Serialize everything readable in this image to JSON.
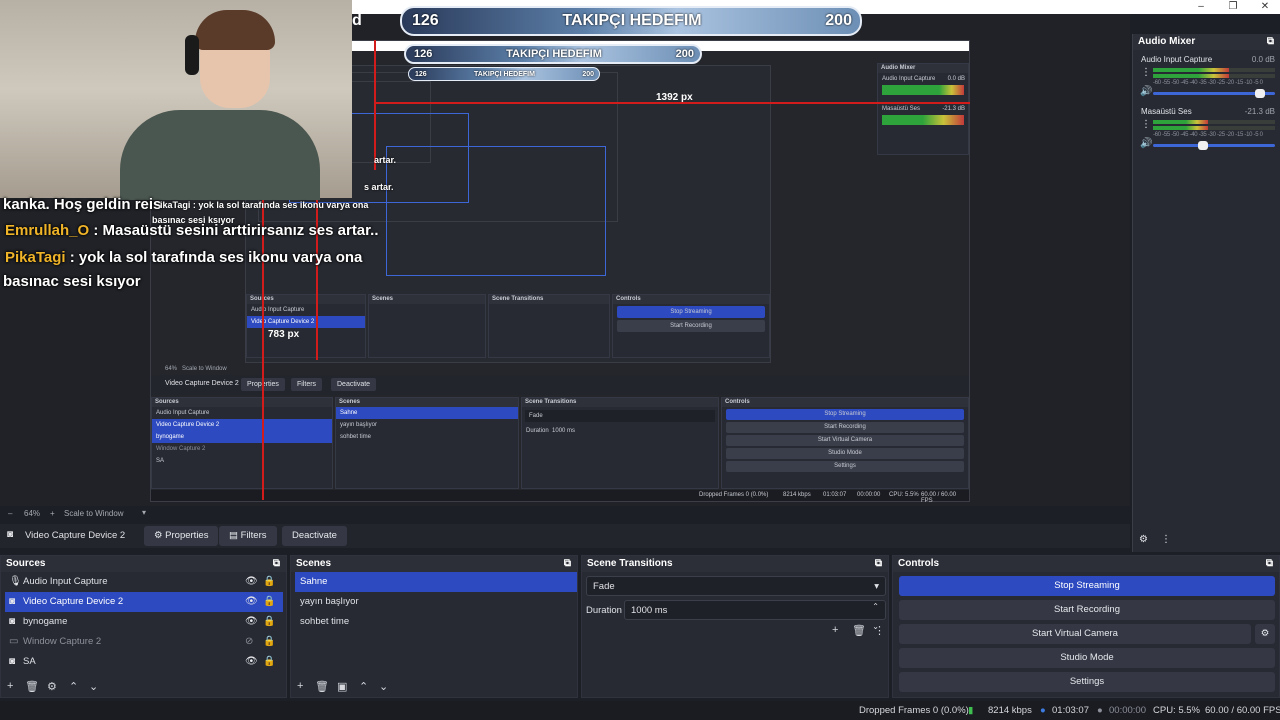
{
  "window": {
    "minimize": "–",
    "maximize": "❐",
    "close": "✕"
  },
  "goal": {
    "left_value": "126",
    "title": "TAKIPÇI HEDEFIM",
    "right_value": "200",
    "partial_label": "d"
  },
  "chat": {
    "line1": "kanka. Hoş geldin reis",
    "line2_nick": "Emrullah_O",
    "line2_msg": " : Masaüstü sesini arttirirsanız ses artar..",
    "line3_nick": "PikaTagi",
    "line3_msg": " : yok la sol tarafında ses ikonu varya ona",
    "line4": "basınac sesi ksıyor",
    "echo1": "ikaTagi : yok la sol tarafında ses ikonu varya ona",
    "echo2": "basınac sesi ksıyor",
    "echo3": "artar.",
    "echo4": "s artar."
  },
  "measure": {
    "width_label": "1392 px",
    "height_label": "783 px"
  },
  "preview_bar": {
    "zoom": "64%",
    "scale": "Scale to Window"
  },
  "context": {
    "source": "Video Capture Device 2",
    "properties": "Properties",
    "filters": "Filters",
    "deactivate": "Deactivate"
  },
  "mixer": {
    "title": "Audio Mixer",
    "channels": [
      {
        "name": "Audio Input Capture",
        "db": "0.0 dB",
        "level": 0.62,
        "volume": 0.92
      },
      {
        "name": "Masaüstü Ses",
        "db": "-21.3 dB",
        "level": 0.45,
        "volume": 0.45
      }
    ],
    "scale": "-60 -55 -50 -45 -40 -35 -30 -25 -20 -15 -10 -5 0"
  },
  "sources": {
    "title": "Sources",
    "items": [
      {
        "name": "Audio Input Capture",
        "icon": "mic-icon"
      },
      {
        "name": "Video Capture Device 2",
        "icon": "camera-icon"
      },
      {
        "name": "bynogame",
        "icon": "camera-icon"
      },
      {
        "name": "Window Capture 2",
        "icon": "window-icon"
      },
      {
        "name": "SA",
        "icon": "camera-icon"
      }
    ]
  },
  "scenes": {
    "title": "Scenes",
    "items": [
      "Sahne",
      "yayın başlıyor",
      "sohbet time"
    ]
  },
  "transitions": {
    "title": "Scene Transitions",
    "type": "Fade",
    "duration_label": "Duration",
    "duration": "1000 ms"
  },
  "controls": {
    "title": "Controls",
    "stop_streaming": "Stop Streaming",
    "start_recording": "Start Recording",
    "start_virtual_camera": "Start Virtual Camera",
    "studio_mode": "Studio Mode",
    "settings": "Settings"
  },
  "status": {
    "dropped": "Dropped Frames 0 (0.0%)",
    "kbps": "8214 kbps",
    "stream_time": "01:03:07",
    "rec_time": "00:00:00",
    "cpu": "CPU: 5.5%",
    "fps": "60.00 / 60.00 FPS"
  },
  "nested": {
    "audio_mixer": "Audio Mixer",
    "audio_input": "Audio Input Capture",
    "masaustu": "Masaüstü Ses",
    "db0": "0.0 dB",
    "db21": "-21.3 dB",
    "sources": "Sources",
    "scenes": "Scenes",
    "transitions": "Scene Transitions",
    "controls": "Controls",
    "fade": "Fade",
    "duration": "Duration",
    "ms": "1000 ms",
    "stop_streaming": "Stop Streaming",
    "start_recording": "Start Recording",
    "start_virtual": "Start Virtual Camera",
    "studio": "Studio Mode",
    "settings": "Settings",
    "properties": "Properties",
    "filters": "Filters",
    "deactivate": "Deactivate",
    "device": "Video Capture Device 2",
    "zoom": "64%",
    "scale": "Scale to Window",
    "dropped": "Dropped Frames 0 (0.0%)",
    "kbps": "8214 kbps",
    "time": "01:03:07",
    "rec": "00:00:00",
    "cpu": "CPU: 5.5%",
    "fps": "60.00 / 60.00 FPS"
  }
}
